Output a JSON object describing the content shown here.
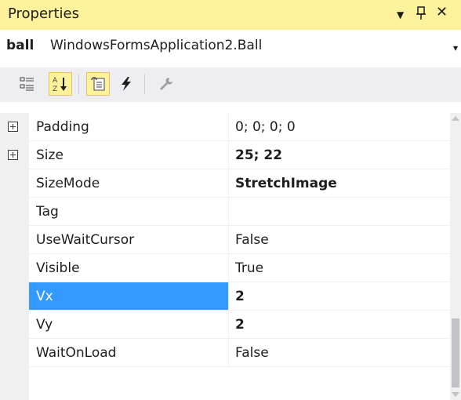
{
  "panel": {
    "title": "Properties",
    "accent_color": "#fff29d"
  },
  "object": {
    "name": "ball",
    "type": "WindowsFormsApplication2.Ball"
  },
  "toolbar": {
    "buttons": [
      {
        "name": "categorized-icon",
        "active": false
      },
      {
        "name": "alphabetical-icon",
        "active": true
      },
      {
        "name": "properties-icon",
        "active": true
      },
      {
        "name": "events-icon",
        "active": false
      },
      {
        "name": "property-pages-icon",
        "active": false
      }
    ]
  },
  "properties": [
    {
      "name": "Padding",
      "value": "0; 0; 0; 0",
      "expandable": true,
      "bold": false,
      "selected": false
    },
    {
      "name": "Size",
      "value": "25; 22",
      "expandable": true,
      "bold": true,
      "selected": false
    },
    {
      "name": "SizeMode",
      "value": "StretchImage",
      "expandable": false,
      "bold": true,
      "selected": false
    },
    {
      "name": "Tag",
      "value": "",
      "expandable": false,
      "bold": false,
      "selected": false
    },
    {
      "name": "UseWaitCursor",
      "value": "False",
      "expandable": false,
      "bold": false,
      "selected": false
    },
    {
      "name": "Visible",
      "value": "True",
      "expandable": false,
      "bold": false,
      "selected": false
    },
    {
      "name": "Vx",
      "value": "2",
      "expandable": false,
      "bold": true,
      "selected": true
    },
    {
      "name": "Vy",
      "value": "2",
      "expandable": false,
      "bold": true,
      "selected": false
    },
    {
      "name": "WaitOnLoad",
      "value": "False",
      "expandable": false,
      "bold": false,
      "selected": false
    }
  ],
  "selection_color": "#3399ff"
}
